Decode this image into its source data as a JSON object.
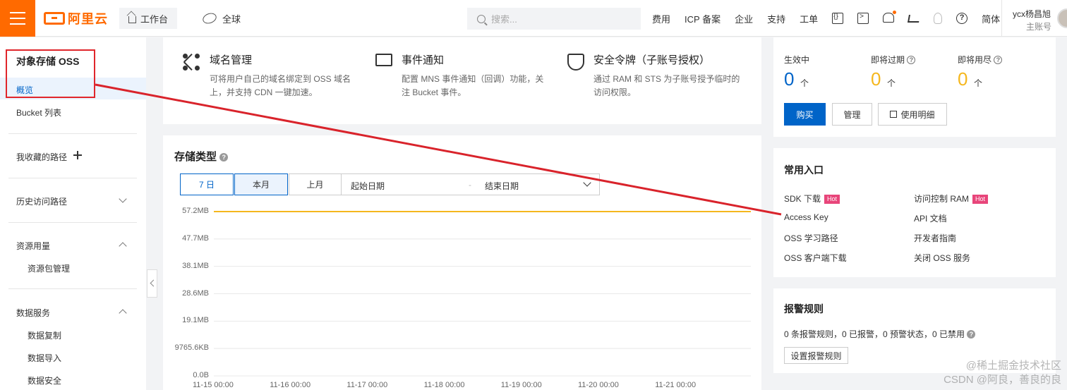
{
  "topbar": {
    "logo_text": "阿里云",
    "workbench": "工作台",
    "region": "全球",
    "search_placeholder": "搜索...",
    "nav": [
      "费用",
      "ICP 备案",
      "企业",
      "支持",
      "工单"
    ],
    "lang": "简体",
    "user_name": "ycx杨昌旭",
    "user_role": "主账号",
    "icons": [
      "code-icon",
      "terminal-icon",
      "bell-icon",
      "cart-icon",
      "bulb-icon",
      "help-icon"
    ]
  },
  "sidebar": {
    "title": "对象存储 OSS",
    "items": [
      "概览",
      "Bucket 列表",
      "我收藏的路径",
      "历史访问路径",
      "资源用量",
      "资源包管理",
      "数据服务",
      "数据复制",
      "数据导入",
      "数据安全"
    ]
  },
  "features": [
    {
      "title": "域名管理",
      "desc": "可将用户自己的域名绑定到 OSS 域名上，并支持 CDN 一键加速。",
      "icon": "network-icon"
    },
    {
      "title": "事件通知",
      "desc": "配置 MNS 事件通知（回调）功能，关注 Bucket 事件。",
      "icon": "message-icon"
    },
    {
      "title": "安全令牌（子账号授权）",
      "desc": "通过 RAM 和 STS 为子账号授予临时的访问权限。",
      "icon": "shield-icon"
    }
  ],
  "storage": {
    "title": "存储类型",
    "ranges": [
      "7 日",
      "本月",
      "上月"
    ],
    "start_placeholder": "起始日期",
    "end_placeholder": "结束日期"
  },
  "chart_data": {
    "type": "line",
    "title": "",
    "y_ticks": [
      "57.2MB",
      "47.7MB",
      "38.1MB",
      "28.6MB",
      "19.1MB",
      "9765.6KB",
      "0.0B"
    ],
    "x_ticks": [
      "11-15 00:00",
      "11-16 00:00",
      "11-17 00:00",
      "11-18 00:00",
      "11-19 00:00",
      "11-20 00:00",
      "11-21 00:00"
    ],
    "ylim": [
      0,
      57.2
    ],
    "yunit": "MB",
    "series": [
      {
        "values": [
          57.2,
          57.2,
          57.2,
          57.2,
          57.2,
          57.2,
          57.2,
          57.2
        ]
      }
    ],
    "series_color": "#f5b71e",
    "grid": true
  },
  "resource_pack": {
    "stats": [
      {
        "label": "生效中",
        "value": "0",
        "unit": "个",
        "color": "#0064c8"
      },
      {
        "label": "即将过期",
        "value": "0",
        "unit": "个",
        "color": "#f5b71e"
      },
      {
        "label": "即将用尽",
        "value": "0",
        "unit": "个",
        "color": "#f5b71e"
      }
    ],
    "buy": "购买",
    "manage": "管理",
    "usage": "使用明细"
  },
  "quick": {
    "title": "常用入口",
    "hot": "Hot",
    "links": [
      "SDK 下载",
      "访问控制 RAM",
      "Access Key",
      "API 文档",
      "OSS 学习路径",
      "开发者指南",
      "OSS 客户端下载",
      "关闭 OSS 服务"
    ]
  },
  "alerts": {
    "title": "报警规则",
    "summary": "0 条报警规则，0 已报警，0 预警状态，0 已禁用",
    "button": "设置报警规则"
  },
  "watermark": [
    "@稀土掘金技术社区",
    "CSDN @阿良，善良的良"
  ]
}
